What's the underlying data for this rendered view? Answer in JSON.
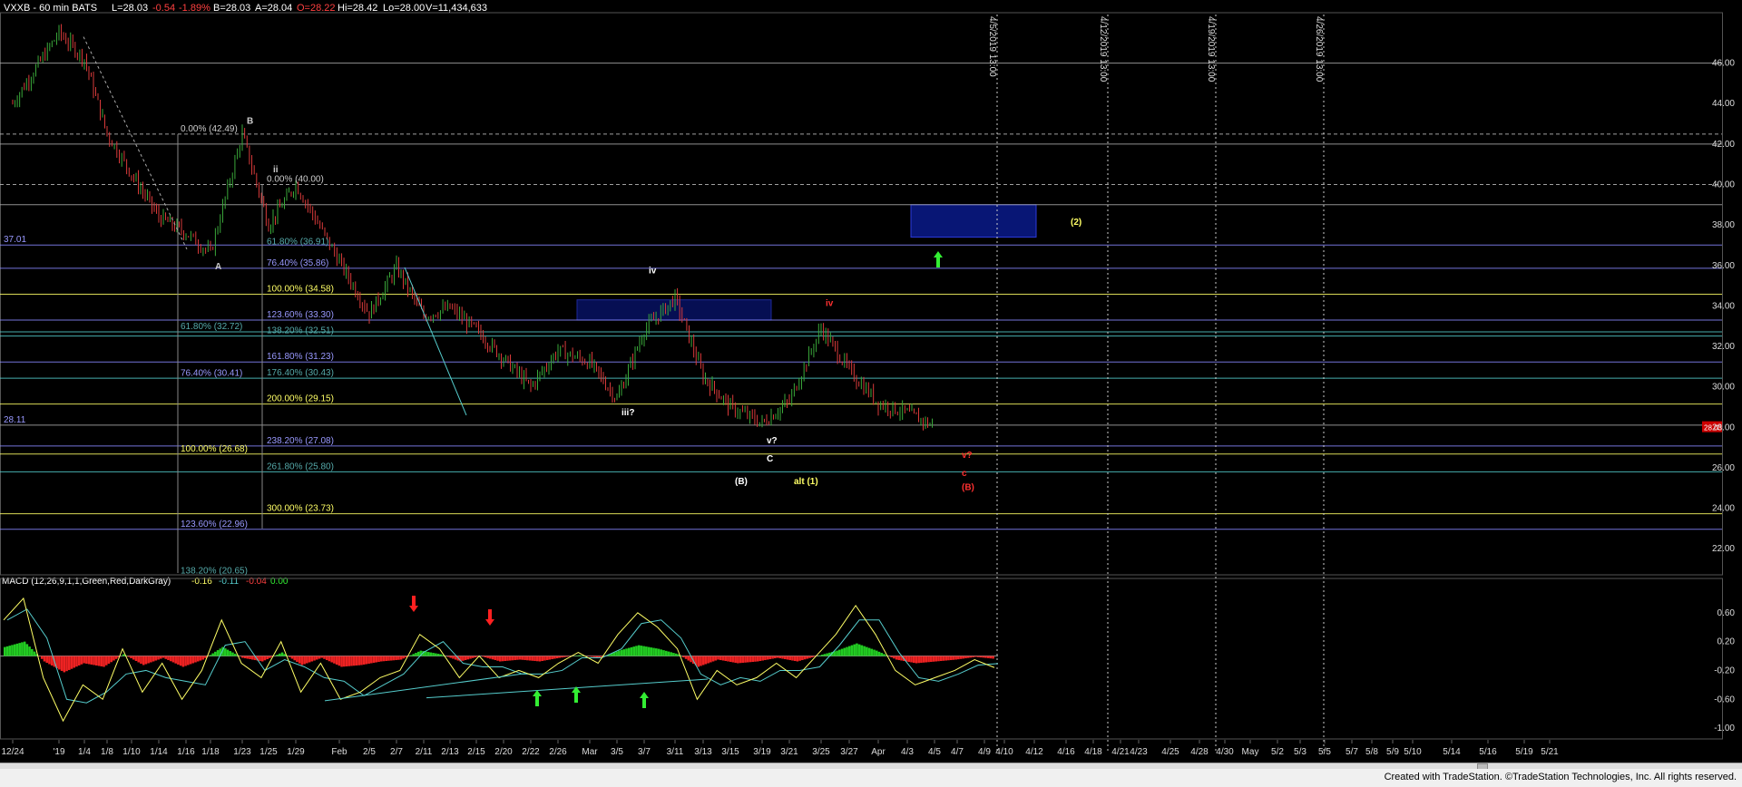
{
  "header": {
    "symbol": "VXXB - 60 min  BATS",
    "last": "L=28.03",
    "change": "-0.54",
    "change_pct": "-1.89%",
    "bid": "B=28.03",
    "ask": "A=28.04",
    "open": "O=28.22",
    "high": "Hi=28.42",
    "low": "Lo=28.00",
    "volume": "V=11,434,633"
  },
  "macd_header": {
    "label": "MACD (12,26,9,1,1,Green,Red,DarkGray)",
    "v1": "-0.16",
    "v2": "-0.11",
    "v3": "-0.04",
    "v4": "0.00"
  },
  "footer": {
    "credit": "Created with TradeStation. ©TradeStation Technologies, Inc. All rights reserved."
  },
  "colors": {
    "background": "#000000",
    "bull_candle": "#3aa83a",
    "bear_candle": "#d83a3a",
    "box_fill": "#0a1a8a",
    "yellow": "#ffff66",
    "blue_line": "#8888ff",
    "teal": "#55cccc",
    "red": "#ff2020",
    "green_arrow": "#33ee33"
  },
  "chart_data": [
    {
      "type": "line",
      "title": "VXXB - 60 min  BATS",
      "xlabel": "",
      "ylabel": "",
      "ylim": [
        20.8,
        48.4
      ],
      "y_ticks": [
        "22.00",
        "24.00",
        "26.00",
        "28.00",
        "30.00",
        "32.00",
        "34.00",
        "36.00",
        "38.00",
        "40.00",
        "42.00",
        "44.00",
        "46.00"
      ],
      "x_ticks": [
        "12/24",
        "'19",
        "1/4",
        "1/8",
        "1/10",
        "1/14",
        "1/16",
        "1/18",
        "1/23",
        "1/25",
        "1/29",
        "Feb",
        "2/5",
        "2/7",
        "2/11",
        "2/13",
        "2/15",
        "2/20",
        "2/22",
        "2/26",
        "Mar",
        "3/5",
        "3/7",
        "3/11",
        "3/13",
        "3/15",
        "3/19",
        "3/21",
        "3/25",
        "3/27",
        "Apr",
        "4/3",
        "4/5",
        "4/7",
        "4/9",
        "4/10",
        "4/12",
        "4/16",
        "4/18",
        "4/21",
        "4/23",
        "4/25",
        "4/28",
        "4/30",
        "May",
        "5/2",
        "5/3",
        "5/5",
        "5/7",
        "5/8",
        "5/9",
        "5/10",
        "5/14",
        "5/16",
        "5/19",
        "5/21"
      ],
      "last_price_label": "28.03",
      "series": [
        {
          "values": [
            {
              "x": "12/24",
              "y": 44.0
            },
            {
              "x": "'19",
              "y": 47.5
            },
            {
              "x": "1/4",
              "y": 46.2
            },
            {
              "x": "1/8",
              "y": 42.5
            },
            {
              "x": "1/10",
              "y": 40.5
            },
            {
              "x": "1/14",
              "y": 38.4
            },
            {
              "x": "1/16",
              "y": 37.6
            },
            {
              "x": "1/18",
              "y": 36.6
            },
            {
              "x": "1/23",
              "y": 42.49
            },
            {
              "x": "1/25",
              "y": 38.0
            },
            {
              "x": "1/29",
              "y": 40.0
            },
            {
              "x": "Feb",
              "y": 36.2
            },
            {
              "x": "2/5",
              "y": 33.6
            },
            {
              "x": "2/7",
              "y": 35.9
            },
            {
              "x": "2/11",
              "y": 33.5
            },
            {
              "x": "2/13",
              "y": 33.9
            },
            {
              "x": "2/15",
              "y": 32.8
            },
            {
              "x": "2/20",
              "y": 31.4
            },
            {
              "x": "2/22",
              "y": 30.0
            },
            {
              "x": "2/26",
              "y": 31.8
            },
            {
              "x": "Mar",
              "y": 31.2
            },
            {
              "x": "3/5",
              "y": 29.4
            },
            {
              "x": "3/7",
              "y": 32.8
            },
            {
              "x": "3/11",
              "y": 34.4
            },
            {
              "x": "3/13",
              "y": 30.5
            },
            {
              "x": "3/15",
              "y": 29.0
            },
            {
              "x": "3/19",
              "y": 28.2
            },
            {
              "x": "3/21",
              "y": 29.3
            },
            {
              "x": "3/25",
              "y": 32.9
            },
            {
              "x": "3/27",
              "y": 30.8
            },
            {
              "x": "Apr",
              "y": 29.2
            },
            {
              "x": "4/3",
              "y": 28.7
            },
            {
              "x": "4/5",
              "y": 28.03
            }
          ]
        }
      ],
      "horizontal_levels": [
        {
          "y": 46.0
        },
        {
          "y": 42.49
        },
        {
          "y": 42.0
        },
        {
          "y": 40.0
        },
        {
          "y": 39.0
        },
        {
          "y": 37.01
        },
        {
          "y": 35.86
        },
        {
          "y": 34.58
        },
        {
          "y": 33.3
        },
        {
          "y": 32.72
        },
        {
          "y": 32.51
        },
        {
          "y": 31.23
        },
        {
          "y": 30.43
        },
        {
          "y": 29.15
        },
        {
          "y": 28.11
        },
        {
          "y": 27.08
        },
        {
          "y": 26.68
        },
        {
          "y": 25.8
        },
        {
          "y": 23.73
        },
        {
          "y": 22.96
        }
      ],
      "fib_labels": [
        {
          "text": "0.00% (42.49)",
          "y": 42.49,
          "color": "#cccccc",
          "col": "a"
        },
        {
          "text": "0.00% (40.00)",
          "y": 40.0,
          "color": "#cccccc",
          "col": "b"
        },
        {
          "text": "61.80% (36.91)",
          "y": 36.91,
          "color": "#55aaaa",
          "col": "b"
        },
        {
          "text": "76.40% (35.86)",
          "y": 35.86,
          "color": "#9999ff",
          "col": "b"
        },
        {
          "text": "100.00% (34.58)",
          "y": 34.58,
          "color": "#ffff66",
          "col": "b"
        },
        {
          "text": "123.60% (33.30)",
          "y": 33.3,
          "color": "#9999ff",
          "col": "b"
        },
        {
          "text": "61.80% (32.72)",
          "y": 32.72,
          "color": "#55aaaa",
          "col": "a"
        },
        {
          "text": "138.20% (32.51)",
          "y": 32.51,
          "color": "#55aaaa",
          "col": "b"
        },
        {
          "text": "161.80% (31.23)",
          "y": 31.23,
          "color": "#9999ff",
          "col": "b"
        },
        {
          "text": "76.40% (30.41)",
          "y": 30.41,
          "color": "#9999ff",
          "col": "a"
        },
        {
          "text": "176.40% (30.43)",
          "y": 30.43,
          "color": "#55aaaa",
          "col": "b"
        },
        {
          "text": "200.00% (29.15)",
          "y": 29.15,
          "color": "#ffff66",
          "col": "b"
        },
        {
          "text": "238.20% (27.08)",
          "y": 27.08,
          "color": "#9999ff",
          "col": "b"
        },
        {
          "text": "100.00% (26.68)",
          "y": 26.68,
          "color": "#ffff66",
          "col": "a"
        },
        {
          "text": "261.80% (25.80)",
          "y": 25.8,
          "color": "#55aaaa",
          "col": "b"
        },
        {
          "text": "300.00% (23.73)",
          "y": 23.73,
          "color": "#ffff66",
          "col": "b"
        },
        {
          "text": "123.60% (22.96)",
          "y": 22.96,
          "color": "#9999ff",
          "col": "a"
        },
        {
          "text": "138.20% (20.65)",
          "y": 20.65,
          "color": "#55aaaa",
          "col": "a"
        }
      ],
      "level_labels": [
        {
          "text": "37.01",
          "y": 37.01
        },
        {
          "text": "28.11",
          "y": 28.11
        }
      ],
      "wave_labels": [
        {
          "text": "B",
          "x": "1/23",
          "y": 43.0,
          "color": "#cccccc"
        },
        {
          "text": "A",
          "x": "1/18",
          "y": 35.8,
          "color": "#cccccc"
        },
        {
          "text": "ii",
          "x": "1/25",
          "y": 40.6,
          "color": "#cccccc"
        },
        {
          "text": "iv",
          "x": "3/7",
          "y": 35.6,
          "color": "#ffffff"
        },
        {
          "text": "iii?",
          "x": "3/5",
          "y": 28.6,
          "color": "#ffffff"
        },
        {
          "text": "iv",
          "x": "3/25",
          "y": 34.0,
          "color": "#ff3030"
        },
        {
          "text": "v?",
          "x": "3/19",
          "y": 27.2,
          "color": "#ffffff"
        },
        {
          "text": "C",
          "x": "3/19",
          "y": 26.3,
          "color": "#ffffff"
        },
        {
          "text": "(B)",
          "x": "3/15",
          "y": 25.2,
          "color": "#ffffff"
        },
        {
          "text": "alt (1)",
          "x": "3/21",
          "y": 25.2,
          "color": "#ffff66"
        },
        {
          "text": "v?",
          "x": "4/7",
          "y": 26.5,
          "color": "#ff3030"
        },
        {
          "text": "c",
          "x": "4/7",
          "y": 25.6,
          "color": "#ff3030"
        },
        {
          "text": "(B)",
          "x": "4/7",
          "y": 24.9,
          "color": "#ff3030"
        },
        {
          "text": "(2)",
          "x": "4/16",
          "y": 38.0,
          "color": "#ffff66"
        }
      ],
      "vertical_markers": [
        "4/5/2019 13:00",
        "4/12/2019 13:00",
        "4/19/2019 13:00",
        "4/26/2019 13:00"
      ]
    },
    {
      "type": "line",
      "title": "MACD (12,26,9,1,1,Green,Red,DarkGray)",
      "xlabel": "",
      "ylabel": "",
      "ylim": [
        -1.15,
        0.95
      ],
      "y_ticks": [
        "0.60",
        "0.20",
        "-0.20",
        "-0.60",
        "-1.00"
      ],
      "series": [
        {
          "values": [
            0.5,
            0.8,
            -0.3,
            -0.9,
            -0.4,
            -0.6,
            0.1,
            -0.5,
            -0.1,
            -0.6,
            -0.2,
            0.5,
            -0.1,
            -0.3,
            0.2,
            -0.5,
            -0.1,
            -0.6,
            -0.5,
            -0.3,
            -0.2,
            0.3,
            0.1,
            -0.3,
            0.0,
            -0.3,
            -0.2,
            -0.3,
            -0.1,
            0.05,
            -0.1,
            0.3,
            0.6,
            0.4,
            0.1,
            -0.6,
            -0.2,
            -0.4,
            -0.3,
            -0.1,
            -0.3,
            0.0,
            0.3,
            0.7,
            0.3,
            -0.2,
            -0.4,
            -0.3,
            -0.2,
            -0.05,
            -0.16
          ]
        }
      ]
    }
  ]
}
